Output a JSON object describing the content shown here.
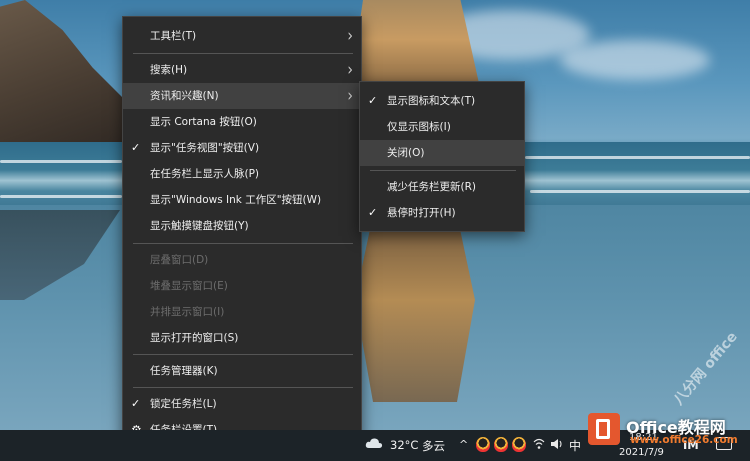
{
  "main_menu": {
    "items": [
      {
        "label": "工具栏(T)",
        "has_submenu": true
      },
      {
        "label": "搜索(H)",
        "has_submenu": true
      },
      {
        "label": "资讯和兴趣(N)",
        "has_submenu": true,
        "highlighted": true
      },
      {
        "label": "显示 Cortana 按钮(O)"
      },
      {
        "label": "显示\"任务视图\"按钮(V)",
        "checked": true
      },
      {
        "label": "在任务栏上显示人脉(P)"
      },
      {
        "label": "显示\"Windows Ink 工作区\"按钮(W)"
      },
      {
        "label": "显示触摸键盘按钮(Y)"
      },
      {
        "label": "层叠窗口(D)",
        "disabled": true
      },
      {
        "label": "堆叠显示窗口(E)",
        "disabled": true
      },
      {
        "label": "并排显示窗口(I)",
        "disabled": true
      },
      {
        "label": "显示打开的窗口(S)"
      },
      {
        "label": "任务管理器(K)"
      },
      {
        "label": "锁定任务栏(L)",
        "checked": true
      },
      {
        "label": "任务栏设置(T)",
        "icon": "gear-icon"
      }
    ]
  },
  "sub_menu": {
    "items": [
      {
        "label": "显示图标和文本(T)",
        "checked": true
      },
      {
        "label": "仅显示图标(I)"
      },
      {
        "label": "关闭(O)",
        "highlighted": true
      },
      {
        "label": "减少任务栏更新(R)"
      },
      {
        "label": "悬停时打开(H)",
        "checked": true
      }
    ]
  },
  "taskbar": {
    "temperature": "32°C",
    "weather": "多云",
    "ime_lang": "中",
    "ime_mode": "IM",
    "time": "18:21",
    "date": "2021/7/9"
  },
  "watermark": {
    "brand": "Office教程网",
    "url": "www.office26.com",
    "diagonal": "八分网 office"
  },
  "glyphs": {
    "check": "✓",
    "gear": "⚙",
    "arrow": "›",
    "caret_up": "^"
  }
}
